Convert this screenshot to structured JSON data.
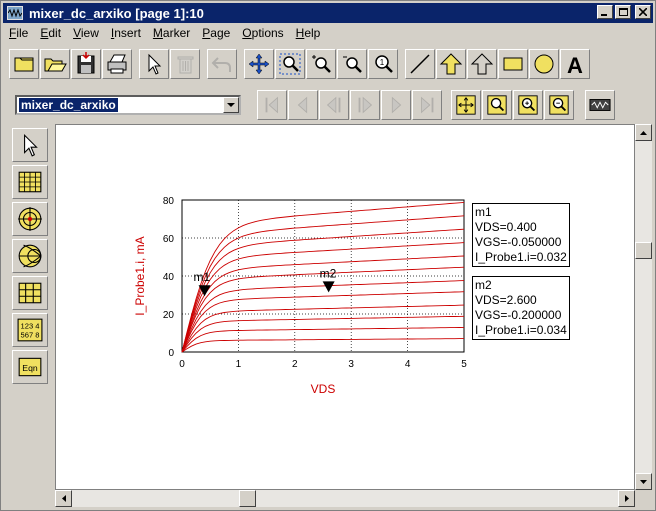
{
  "window": {
    "title": "mixer_dc_arxiko [page 1]:10"
  },
  "menubar": [
    {
      "label": "File",
      "ul": "F",
      "rest": "ile"
    },
    {
      "label": "Edit",
      "ul": "E",
      "rest": "dit"
    },
    {
      "label": "View",
      "ul": "V",
      "rest": "iew"
    },
    {
      "label": "Insert",
      "ul": "I",
      "rest": "nsert"
    },
    {
      "label": "Marker",
      "ul": "M",
      "rest": "arker"
    },
    {
      "label": "Page",
      "ul": "P",
      "rest": "age"
    },
    {
      "label": "Options",
      "ul": "O",
      "rest": "ptions"
    },
    {
      "label": "Help",
      "ul": "H",
      "rest": "elp"
    }
  ],
  "toolbar1": [
    "new-icon",
    "open-icon",
    "save-icon",
    "print-icon",
    "pointer-icon",
    "delete-icon",
    "undo-icon",
    "move-icon",
    "zoom-area-icon",
    "zoom-in-icon",
    "zoom-out-icon",
    "zoom-fit-icon",
    "line-icon",
    "arrow-up-icon",
    "arrow-outline-icon",
    "rectangle-icon",
    "circle-icon",
    "text-icon"
  ],
  "toolbar2": {
    "page_combo": "mixer_dc_arxiko",
    "nav_icons": [
      "first-page-icon",
      "prev-page-icon",
      "prev-icon",
      "next-icon",
      "next-page-icon",
      "last-page-icon"
    ],
    "view_icons": [
      "view-all-icon",
      "zoom-page-icon",
      "zoom-in-page-icon",
      "zoom-out-page-icon",
      "trace-icon"
    ]
  },
  "leftbar": [
    "pointer-icon",
    "grid-icon",
    "polar-icon",
    "smith-icon",
    "list-icon",
    "stack-icon",
    "equation-icon"
  ],
  "leftbar_labels": {
    "stack": "123 4\n567 8",
    "eqn": "Eqn"
  },
  "chart_data": {
    "type": "line",
    "xlabel": "VDS",
    "ylabel": "I_Probe1.i, mA",
    "xlim": [
      0,
      5
    ],
    "ylim": [
      0,
      80
    ],
    "xticks": [
      "0",
      "1",
      "2",
      "3",
      "4",
      "5"
    ],
    "yticks": [
      "0",
      "20",
      "40",
      "60",
      "80"
    ],
    "grid": true,
    "series_color": "#cc0000",
    "curve_saturation_mA": [
      6,
      11,
      16,
      21,
      27,
      32,
      38,
      43,
      49,
      55,
      61,
      67
    ],
    "markers": [
      {
        "name": "m1",
        "x": 0.4,
        "y": 32,
        "lines": [
          "m1",
          "VDS=0.400",
          "VGS=-0.050000",
          "I_Probe1.i=0.032"
        ]
      },
      {
        "name": "m2",
        "x": 2.6,
        "y": 34,
        "lines": [
          "m2",
          "VDS=2.600",
          "VGS=-0.200000",
          "I_Probe1.i=0.034"
        ]
      }
    ]
  }
}
